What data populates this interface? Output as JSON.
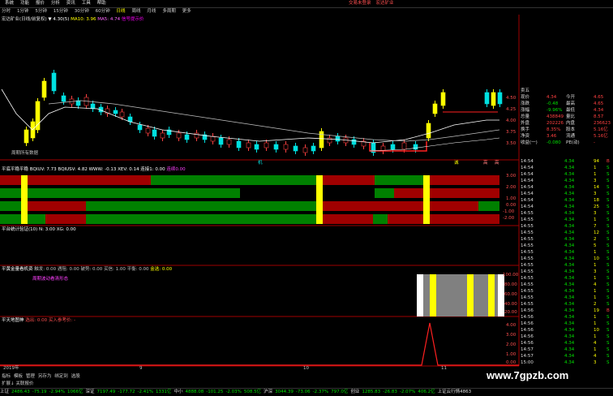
{
  "menu": {
    "items": [
      "系统",
      "功能",
      "报价",
      "分析",
      "资讯",
      "工具",
      "帮助"
    ],
    "brand_items": [
      "交易未登录",
      "宏达矿业"
    ]
  },
  "tabs": {
    "items": [
      "分时",
      "1分钟",
      "5分钟",
      "15分钟",
      "30分钟",
      "60分钟",
      "日线",
      "周线",
      "月线",
      "多周期",
      "更多"
    ],
    "active": "日线"
  },
  "main_info": {
    "title": "宏达矿业(日线/前复权)",
    "ma5": "▼ 4.30(5)",
    "ma10": "MA10: 3.96",
    "ma30": "MA5: 4.74",
    "signal": "信号提示价"
  },
  "main_chart": {
    "legend_hint": "周期所有数据",
    "y_ticks": [
      "4.50",
      "4.25",
      "4.00",
      "3.75",
      "3.50"
    ],
    "marks": [
      "机",
      "诚",
      "高",
      "高"
    ]
  },
  "panel1": {
    "title": "平底平稳平稳",
    "values": "BQIUV: 7.73  BQIUSV: 4.82  WWW: -0.13  XEV: 0.14  连接1: 0.00",
    "value_extra": "连续0.00",
    "y_ticks": [
      "3.00",
      "2.00",
      "1.00",
      "0.00",
      "-1.00",
      "-2.00"
    ]
  },
  "panel2": {
    "title": "平台统计验证(10) N: 3.00 XG: 0.00"
  },
  "panel3": {
    "title": "平黄金量看机资",
    "values": "触发: 0.00  遇阻: 0.00  破势: 0.00  买信: 1.00  平衡: 0.00",
    "extra": "金选: 0.00",
    "hint": "周期波动看清形态",
    "y_ticks": [
      "100.00",
      "80.00",
      "60.00",
      "40.00",
      "20.00"
    ]
  },
  "panel4": {
    "title": "平天地图神",
    "values": "选出: 0.00  买入参考价: -",
    "y_ticks": [
      "4.00",
      "3.00",
      "2.00",
      "1.00",
      "0.00"
    ]
  },
  "time_axis": {
    "labels": [
      "2019年",
      "9",
      "10",
      "11"
    ]
  },
  "quote_panel": {
    "title": "卖五",
    "rows": [
      {
        "l1": "现价",
        "v1": "4.34",
        "l2": "今开",
        "v2": "4.65"
      },
      {
        "l1": "涨跌",
        "v1": "-0.48",
        "l2": "最高",
        "v2": "4.65"
      },
      {
        "l1": "涨幅",
        "v1": "-9.96%",
        "l2": "最低",
        "v2": "4.34"
      },
      {
        "l1": "总量",
        "v1": "438849",
        "l2": "量比",
        "v2": "8.57"
      },
      {
        "l1": "外盘",
        "v1": "202226",
        "l2": "内盘",
        "v2": "236623"
      },
      {
        "l1": "换手",
        "v1": "8.35%",
        "l2": "股本",
        "v2": "5.16亿"
      },
      {
        "l1": "净资",
        "v1": "3.46",
        "l2": "流通",
        "v2": "5.16亿"
      },
      {
        "l1": "收益(一)",
        "v1": "-0.080",
        "l2": "PE(动)",
        "v2": "-"
      }
    ]
  },
  "ticks": [
    {
      "t": "14:54",
      "p": "4.34",
      "v": "94",
      "n": "B"
    },
    {
      "t": "14:54",
      "p": "4.34",
      "v": "1",
      "n": "S"
    },
    {
      "t": "14:54",
      "p": "4.34",
      "v": "1",
      "n": "S"
    },
    {
      "t": "14:54",
      "p": "4.34",
      "v": "3",
      "n": "S"
    },
    {
      "t": "14:54",
      "p": "4.34",
      "v": "14",
      "n": "S"
    },
    {
      "t": "14:54",
      "p": "4.34",
      "v": "3",
      "n": "S"
    },
    {
      "t": "14:54",
      "p": "4.34",
      "v": "18",
      "n": "S"
    },
    {
      "t": "14:54",
      "p": "4.34",
      "v": "25",
      "n": "S"
    },
    {
      "t": "14:55",
      "p": "4.34",
      "v": "3",
      "n": "S"
    },
    {
      "t": "14:55",
      "p": "4.34",
      "v": "1",
      "n": "S"
    },
    {
      "t": "14:55",
      "p": "4.34",
      "v": "7",
      "n": "S"
    },
    {
      "t": "14:55",
      "p": "4.34",
      "v": "12",
      "n": "S"
    },
    {
      "t": "14:55",
      "p": "4.34",
      "v": "2",
      "n": "S"
    },
    {
      "t": "14:55",
      "p": "4.34",
      "v": "5",
      "n": "S"
    },
    {
      "t": "14:55",
      "p": "4.34",
      "v": "1",
      "n": "S"
    },
    {
      "t": "14:55",
      "p": "4.34",
      "v": "10",
      "n": "S"
    },
    {
      "t": "14:55",
      "p": "4.34",
      "v": "1",
      "n": "S"
    },
    {
      "t": "14:55",
      "p": "4.34",
      "v": "3",
      "n": "S"
    },
    {
      "t": "14:55",
      "p": "4.34",
      "v": "1",
      "n": "S"
    },
    {
      "t": "14:55",
      "p": "4.34",
      "v": "4",
      "n": "S"
    },
    {
      "t": "14:55",
      "p": "4.34",
      "v": "1",
      "n": "S"
    },
    {
      "t": "14:55",
      "p": "4.34",
      "v": "1",
      "n": "S"
    },
    {
      "t": "14:55",
      "p": "4.34",
      "v": "2",
      "n": "S"
    },
    {
      "t": "14:56",
      "p": "4.34",
      "v": "19",
      "n": "B"
    },
    {
      "t": "14:56",
      "p": "4.34",
      "v": "1",
      "n": "S"
    },
    {
      "t": "14:56",
      "p": "4.34",
      "v": "1",
      "n": "S"
    },
    {
      "t": "14:56",
      "p": "4.34",
      "v": "10",
      "n": "S"
    },
    {
      "t": "14:56",
      "p": "4.34",
      "v": "1",
      "n": "S"
    },
    {
      "t": "14:56",
      "p": "4.34",
      "v": "4",
      "n": "S"
    },
    {
      "t": "14:57",
      "p": "4.34",
      "v": "1",
      "n": "S"
    },
    {
      "t": "14:57",
      "p": "4.34",
      "v": "4",
      "n": "S"
    },
    {
      "t": "15:00",
      "p": "4.34",
      "v": "3",
      "n": "S"
    }
  ],
  "bottom_tabs": [
    "指标",
    "模板",
    "管理",
    "另存为",
    "绑定到",
    "选股"
  ],
  "bottom_extra": "扩展↓  关联报价",
  "status": [
    {
      "name": "上证",
      "v": "2486.43",
      "c": "-75.19",
      "p": "-2.94%",
      "a": "1066亿",
      "cls": "dn"
    },
    {
      "name": "深证",
      "v": "7197.49",
      "c": "-177.72",
      "p": "-2.41%",
      "a": "1331亿",
      "cls": "dn"
    },
    {
      "name": "中小",
      "v": "4888.08",
      "c": "-101.25",
      "p": "-2.03%",
      "a": "508.5亿",
      "cls": "dn"
    },
    {
      "name": "沪深",
      "v": "3044.39",
      "c": "-73.06",
      "p": "-2.37%",
      "a": "797.0亿",
      "cls": "dn"
    },
    {
      "name": "创业",
      "v": "1285.83",
      "c": "-26.83",
      "p": "-2.07%",
      "a": "406.2亿",
      "cls": "dn"
    }
  ],
  "status_tail": "上证云行情4863",
  "watermark": "www.7gpzb.com",
  "colors": {
    "up": "#ff4040",
    "down": "#00e0e0",
    "ma5": "#ffffff",
    "ma10": "#ffff00",
    "ma30": "#ff66ff",
    "green_bar": "#008000",
    "red_bar": "#a00000",
    "yellow": "#ffff00",
    "gray": "#808080"
  }
}
